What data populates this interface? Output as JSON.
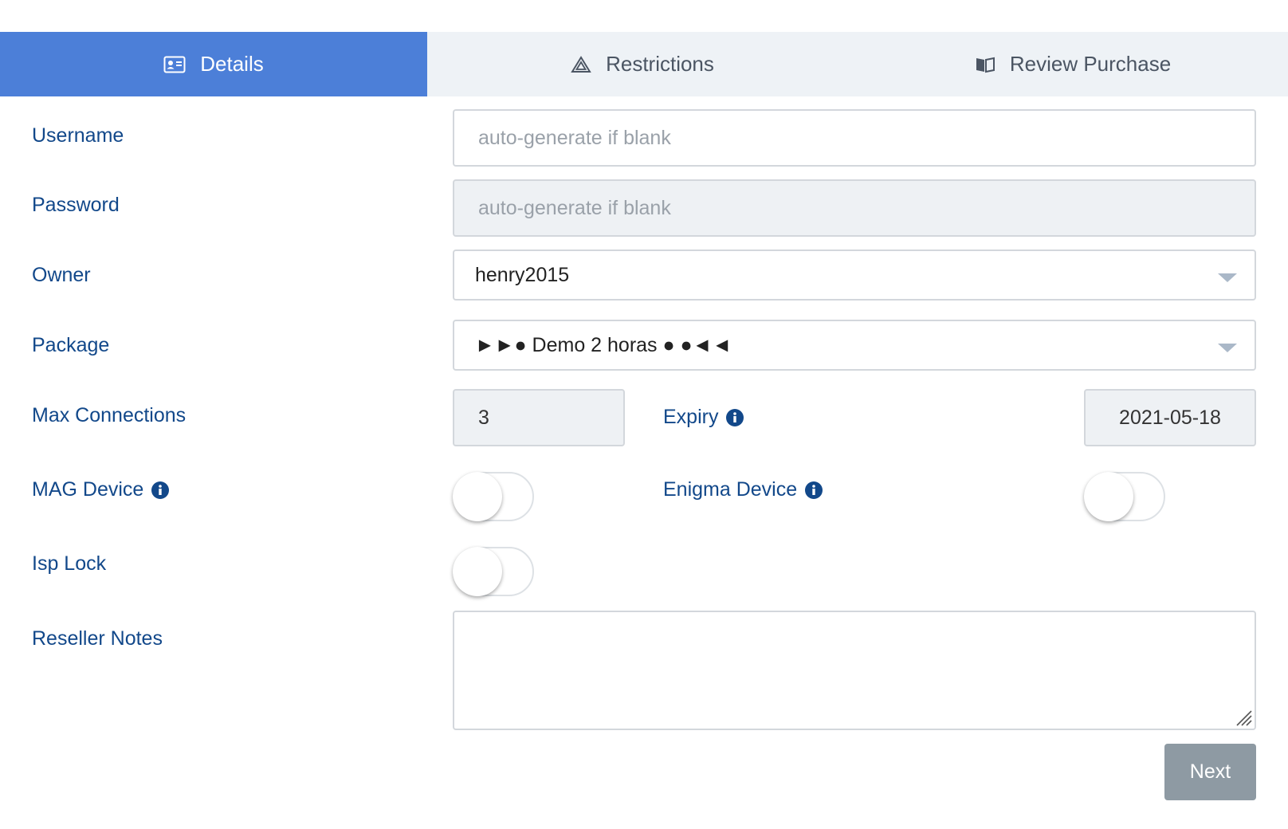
{
  "tabs": [
    {
      "label": "Details",
      "icon": "id-card-icon",
      "active": true
    },
    {
      "label": "Restrictions",
      "icon": "warning-triangle-icon",
      "active": false
    },
    {
      "label": "Review Purchase",
      "icon": "open-book-icon",
      "active": false
    }
  ],
  "form": {
    "username": {
      "label": "Username",
      "placeholder": "auto-generate if blank",
      "value": ""
    },
    "password": {
      "label": "Password",
      "placeholder": "auto-generate if blank",
      "value": ""
    },
    "owner": {
      "label": "Owner",
      "value": "henry2015"
    },
    "package": {
      "label": "Package",
      "value": "►►● Demo 2 horas ● ●◄◄"
    },
    "max_connections": {
      "label": "Max Connections",
      "value": "3"
    },
    "expiry": {
      "label": "Expiry",
      "value": "2021-05-18"
    },
    "mag_device": {
      "label": "MAG Device",
      "on": false
    },
    "enigma_device": {
      "label": "Enigma Device",
      "on": false
    },
    "isp_lock": {
      "label": "Isp Lock",
      "on": false
    },
    "reseller_notes": {
      "label": "Reseller Notes",
      "value": ""
    }
  },
  "actions": {
    "next_label": "Next"
  },
  "colors": {
    "active_tab": "#4c7fd8",
    "label_text": "#12488a",
    "next_button": "#8e9aa3"
  }
}
